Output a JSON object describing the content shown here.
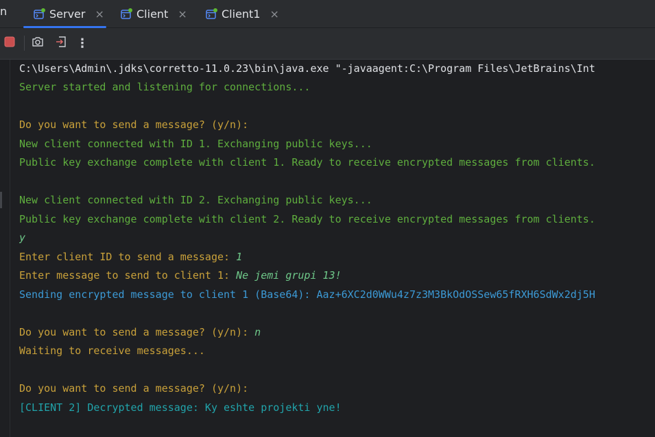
{
  "tabs": {
    "partial_label": "n",
    "items": [
      {
        "label": "Server",
        "close": "×",
        "active": true
      },
      {
        "label": "Client",
        "close": "×",
        "active": false
      },
      {
        "label": "Client1",
        "close": "×",
        "active": false
      }
    ]
  },
  "toolbar": {
    "stop_icon": "stop-square-icon",
    "screenshot_icon": "camera-icon",
    "exit_icon": "exit-icon",
    "more_icon": "more-vertical-icon",
    "more_glyph": "⋮"
  },
  "console": {
    "lines": [
      {
        "text": "C:\\Users\\Admin\\.jdks\\corretto-11.0.23\\bin\\java.exe \"-javaagent:C:\\Program Files\\JetBrains\\Int"
      },
      {
        "text": "Server started and listening for connections..."
      },
      {
        "text": ""
      },
      {
        "text": "Do you want to send a message? (y/n):"
      },
      {
        "text": "New client connected with ID 1. Exchanging public keys..."
      },
      {
        "text": "Public key exchange complete with client 1. Ready to receive encrypted messages from clients."
      },
      {
        "text": ""
      },
      {
        "text": "New client connected with ID 2. Exchanging public keys..."
      },
      {
        "text": "Public key exchange complete with client 2. Ready to receive encrypted messages from clients."
      },
      {
        "text": "",
        "input": "y"
      },
      {
        "text": "Enter client ID to send a message: ",
        "input": "1"
      },
      {
        "text": "Enter message to send to client 1: ",
        "input": "Ne jemi grupi 13!"
      },
      {
        "text": "Sending encrypted message to client 1 (Base64): Aaz+6XC2d0WWu4z7z3M3BkOdOSSew65fRXH6SdWx2dj5H"
      },
      {
        "text": ""
      },
      {
        "text": "Do you want to send a message? (y/n): ",
        "input": "n"
      },
      {
        "text": "Waiting to receive messages..."
      },
      {
        "text": ""
      },
      {
        "text": "Do you want to send a message? (y/n):"
      },
      {
        "text": "[CLIENT 2] Decrypted message: Ky eshte projekti yne!"
      }
    ]
  },
  "colors": {
    "background": "#1e1f22",
    "tab_accent": "#3574f0",
    "green": "#5fae3e",
    "yellow": "#c9a13a",
    "blue": "#3c9ad6",
    "cyan": "#21a4ab",
    "input": "#6fc98a"
  }
}
